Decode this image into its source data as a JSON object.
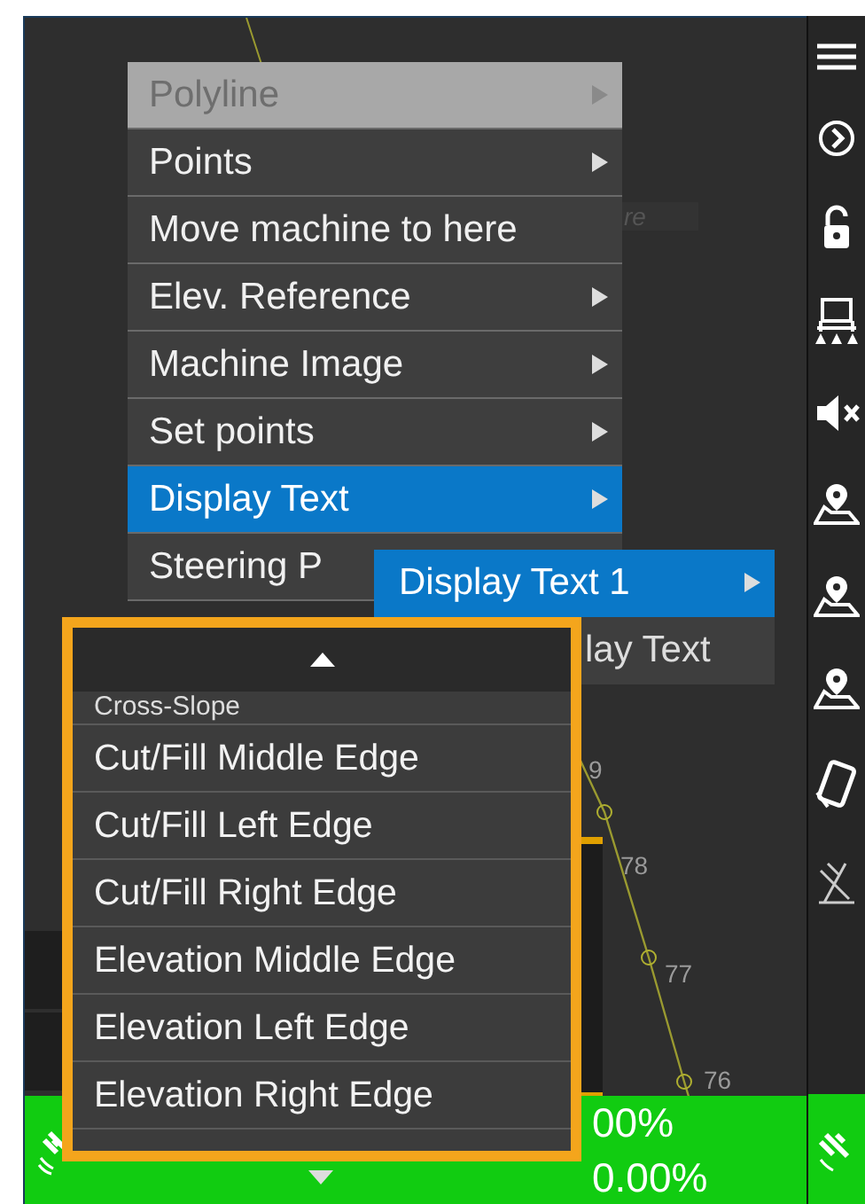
{
  "context_menu": {
    "items": [
      {
        "label": "Polyline",
        "disabled": true,
        "selected": false,
        "has_submenu": true
      },
      {
        "label": "Points",
        "disabled": false,
        "selected": false,
        "has_submenu": true
      },
      {
        "label": "Move machine to here",
        "disabled": false,
        "selected": false,
        "has_submenu": false
      },
      {
        "label": "Elev. Reference",
        "disabled": false,
        "selected": false,
        "has_submenu": true
      },
      {
        "label": "Machine Image",
        "disabled": false,
        "selected": false,
        "has_submenu": true
      },
      {
        "label": "Set points",
        "disabled": false,
        "selected": false,
        "has_submenu": true
      },
      {
        "label": "Display Text",
        "disabled": false,
        "selected": true,
        "has_submenu": true
      },
      {
        "label": "Steering P",
        "disabled": false,
        "selected": false
      }
    ]
  },
  "submenu": {
    "items": [
      {
        "label": "Display Text 1",
        "selected": true,
        "has_submenu": true
      },
      {
        "label": "lay Text",
        "selected": false,
        "has_submenu": false
      }
    ]
  },
  "dropdown": {
    "items": [
      "Cross-Slope",
      "Cut/Fill Middle Edge",
      "Cut/Fill Left Edge",
      "Cut/Fill Right Edge",
      "Elevation Middle Edge",
      "Elevation Left Edge",
      "Elevation Right Edge"
    ]
  },
  "hidden_label": "re",
  "map_labels": [
    "9",
    "78",
    "77",
    "76"
  ],
  "status_bar": {
    "values": [
      "00%",
      "0.00%"
    ]
  }
}
